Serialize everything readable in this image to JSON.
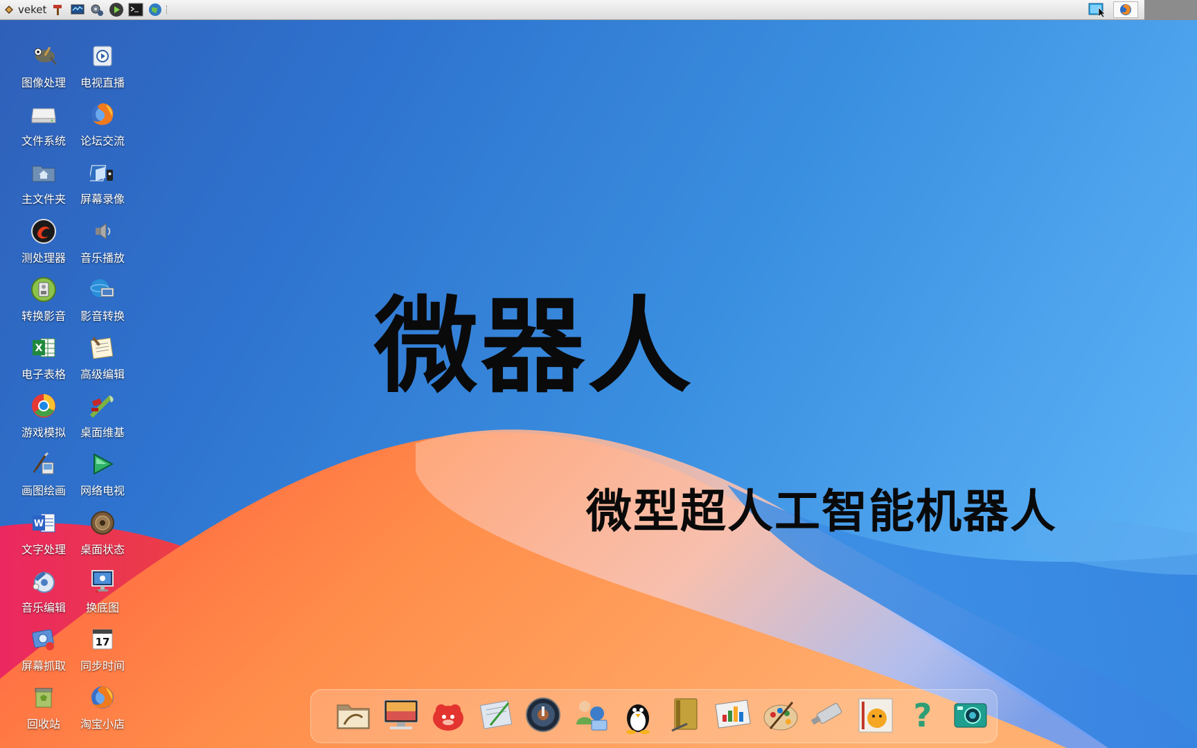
{
  "taskbar": {
    "brand_label": "veket",
    "launchers": [
      "tools-icon",
      "monitor-icon",
      "settings-icon",
      "play-icon",
      "terminal-icon",
      "globe-icon"
    ],
    "tray": [
      "desktop-switch-icon",
      "firefox-tray-icon"
    ]
  },
  "desktop": {
    "icons": [
      {
        "label": "图像处理",
        "icon": "gimp-icon"
      },
      {
        "label": "电视直播",
        "icon": "tv-icon"
      },
      {
        "label": "文件系统",
        "icon": "drive-icon"
      },
      {
        "label": "论坛交流",
        "icon": "firefox-icon"
      },
      {
        "label": "主文件夹",
        "icon": "home-folder-icon"
      },
      {
        "label": "屏幕录像",
        "icon": "screen-record-icon"
      },
      {
        "label": "测处理器",
        "icon": "cpu-test-icon"
      },
      {
        "label": "音乐播放",
        "icon": "speaker-icon"
      },
      {
        "label": "转换影音",
        "icon": "media-convert-icon"
      },
      {
        "label": "影音转换",
        "icon": "media-transcode-icon"
      },
      {
        "label": "电子表格",
        "icon": "spreadsheet-icon"
      },
      {
        "label": "高级编辑",
        "icon": "text-editor-icon"
      },
      {
        "label": "游戏模拟",
        "icon": "game-emulator-icon"
      },
      {
        "label": "桌面维基",
        "icon": "wiki-icon"
      },
      {
        "label": "画图绘画",
        "icon": "paint-icon"
      },
      {
        "label": "网络电视",
        "icon": "play-triangle-icon"
      },
      {
        "label": "文字处理",
        "icon": "word-processor-icon"
      },
      {
        "label": "桌面状态",
        "icon": "desktop-status-icon"
      },
      {
        "label": "音乐编辑",
        "icon": "audio-edit-icon"
      },
      {
        "label": "换底图",
        "icon": "wallpaper-icon"
      },
      {
        "label": "屏幕抓取",
        "icon": "screenshot-icon"
      },
      {
        "label": "同步时间",
        "icon": "calendar-icon"
      },
      {
        "label": "回收站",
        "icon": "trash-icon"
      },
      {
        "label": "淘宝小店",
        "icon": "shop-icon"
      }
    ],
    "calendar_day": "17"
  },
  "wallpaper": {
    "title": "微器人",
    "subtitle": "微型超人工智能机器人"
  },
  "dock": {
    "items": [
      "file-manager-icon",
      "computer-icon",
      "mascot-icon",
      "notepad-icon",
      "media-player-icon",
      "contacts-icon",
      "qq-penguin-icon",
      "notebook-icon",
      "presentation-icon",
      "paint-palette-icon",
      "usb-drive-icon",
      "veket-pet-icon",
      "help-icon",
      "camera-icon"
    ]
  },
  "colors": {
    "bg_blue": "#2e73cf",
    "wave_orange": "#ff8a3d",
    "wave_red": "#f2244e"
  }
}
